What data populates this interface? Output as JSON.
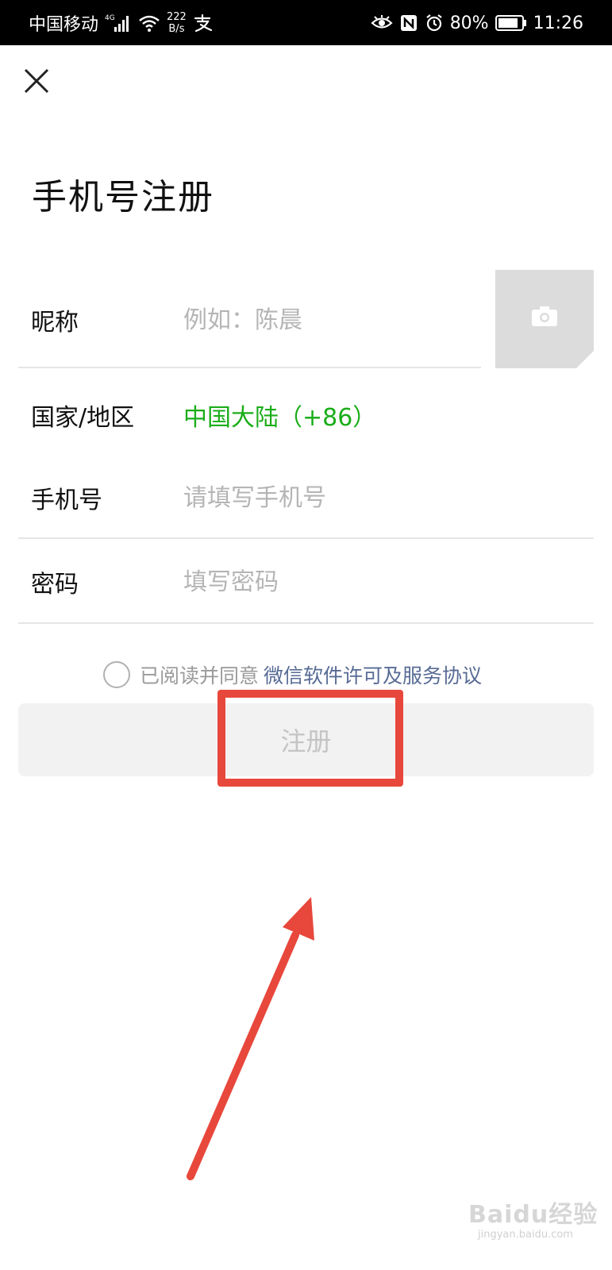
{
  "status_bar": {
    "carrier": "中国移动",
    "network_type": "4G",
    "speed_value": "222",
    "speed_unit": "B/s",
    "battery": "80%",
    "time": "11:26"
  },
  "header": {
    "title": "手机号注册"
  },
  "form": {
    "nickname": {
      "label": "昵称",
      "placeholder": "例如：陈晨"
    },
    "region": {
      "label": "国家/地区",
      "value": "中国大陆（+86）"
    },
    "phone": {
      "label": "手机号",
      "placeholder": "请填写手机号"
    },
    "password": {
      "label": "密码",
      "placeholder": "填写密码"
    }
  },
  "agreement": {
    "prefix": "已阅读并同意",
    "link": "微信软件许可及服务协议"
  },
  "register_button": {
    "label": "注册"
  },
  "watermark": {
    "text": "Baidu经验",
    "sub": "jingyan.baidu.com"
  },
  "colors": {
    "accent_green": "#1aad19",
    "link_blue": "#576b95",
    "annotation_red": "#e8473c"
  },
  "icons": [
    "signal-icon",
    "wifi-icon",
    "alipay-icon",
    "eye-icon",
    "nfc-icon",
    "alarm-icon",
    "battery-icon",
    "close-icon",
    "camera-icon",
    "radio-icon"
  ]
}
